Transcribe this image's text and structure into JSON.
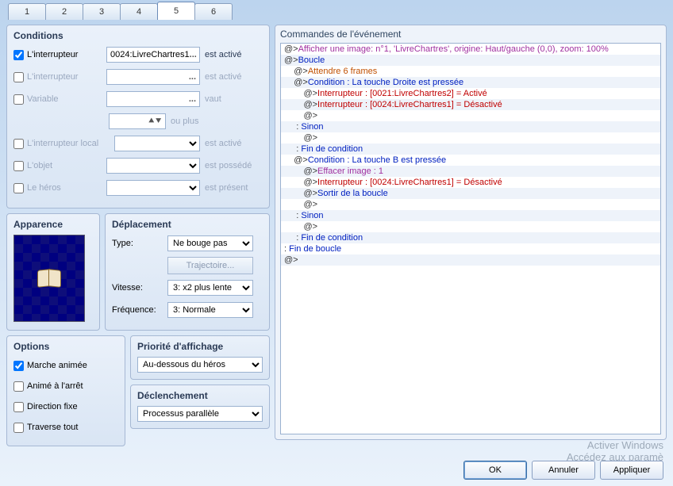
{
  "tabs": [
    "1",
    "2",
    "3",
    "4",
    "5",
    "6"
  ],
  "activeTab": 4,
  "groups": {
    "conditions": "Conditions",
    "appearance": "Apparence",
    "movement": "Déplacement",
    "options": "Options",
    "priority": "Priorité d'affichage",
    "trigger": "Déclenchement",
    "commands": "Commandes de l'événement"
  },
  "conditions": {
    "switch1": {
      "label": "L'interrupteur",
      "checked": true,
      "value": "0024:LivreChartres1",
      "suffix": "est activé"
    },
    "switch2": {
      "label": "L'interrupteur",
      "checked": false,
      "value": "",
      "suffix": "est activé"
    },
    "variable": {
      "label": "Variable",
      "checked": false,
      "value": "",
      "suffix": "vaut",
      "value2": "",
      "suffix2": "ou plus"
    },
    "selfSwitch": {
      "label": "L'interrupteur local",
      "checked": false,
      "suffix": "est activé"
    },
    "item": {
      "label": "L'objet",
      "checked": false,
      "suffix": "est possédé"
    },
    "hero": {
      "label": "Le héros",
      "checked": false,
      "suffix": "est présent"
    }
  },
  "movement": {
    "typeLabel": "Type:",
    "typeValue": "Ne bouge pas",
    "trajBtn": "Trajectoire...",
    "speedLabel": "Vitesse:",
    "speedValue": "3: x2 plus lente",
    "freqLabel": "Fréquence:",
    "freqValue": "3: Normale"
  },
  "options": {
    "walkAnim": {
      "label": "Marche animée",
      "checked": true
    },
    "stopAnim": {
      "label": "Animé à l'arrêt",
      "checked": false
    },
    "fixDir": {
      "label": "Direction fixe",
      "checked": false
    },
    "through": {
      "label": "Traverse tout",
      "checked": false
    }
  },
  "priority": {
    "value": "Au-dessous du héros"
  },
  "trigger": {
    "value": "Processus parallèle"
  },
  "commands": [
    {
      "indent": 0,
      "prefix": "@>",
      "class": "purple",
      "text": "Afficher une image: n°1, 'LivreChartres', origine: Haut/gauche (0,0), zoom: 100%"
    },
    {
      "indent": 0,
      "prefix": "@>",
      "class": "blue",
      "text": "Boucle"
    },
    {
      "indent": 1,
      "prefix": "@>",
      "class": "orange",
      "text": "Attendre 6 frames"
    },
    {
      "indent": 1,
      "prefix": "@>",
      "class": "blue",
      "text": "Condition : La touche Droite est pressée"
    },
    {
      "indent": 2,
      "prefix": "@>",
      "class": "red",
      "text": "Interrupteur : [0021:LivreChartres2] = Activé"
    },
    {
      "indent": 2,
      "prefix": "@>",
      "class": "red",
      "text": "Interrupteur : [0024:LivreChartres1] = Désactivé"
    },
    {
      "indent": 2,
      "prefix": "@>",
      "class": "m",
      "text": ""
    },
    {
      "indent": 1,
      "prefix": " : ",
      "class": "blue",
      "text": "Sinon"
    },
    {
      "indent": 2,
      "prefix": "@>",
      "class": "m",
      "text": ""
    },
    {
      "indent": 1,
      "prefix": " : ",
      "class": "blue",
      "text": "Fin de condition"
    },
    {
      "indent": 1,
      "prefix": "@>",
      "class": "blue",
      "text": "Condition : La touche B est pressée"
    },
    {
      "indent": 2,
      "prefix": "@>",
      "class": "purple",
      "text": "Effacer image : 1"
    },
    {
      "indent": 2,
      "prefix": "@>",
      "class": "red",
      "text": "Interrupteur : [0024:LivreChartres1] = Désactivé"
    },
    {
      "indent": 2,
      "prefix": "@>",
      "class": "blue",
      "text": "Sortir de la boucle"
    },
    {
      "indent": 2,
      "prefix": "@>",
      "class": "m",
      "text": ""
    },
    {
      "indent": 1,
      "prefix": " : ",
      "class": "blue",
      "text": "Sinon"
    },
    {
      "indent": 2,
      "prefix": "@>",
      "class": "m",
      "text": ""
    },
    {
      "indent": 1,
      "prefix": " : ",
      "class": "blue",
      "text": "Fin de condition"
    },
    {
      "indent": 0,
      "prefix": " : ",
      "class": "blue",
      "text": "Fin de boucle"
    },
    {
      "indent": 0,
      "prefix": "@>",
      "class": "m",
      "text": ""
    }
  ],
  "buttons": {
    "ok": "OK",
    "cancel": "Annuler",
    "apply": "Appliquer"
  },
  "watermark": {
    "l1": "Activer Windows",
    "l2": "Accédez aux paramè"
  }
}
